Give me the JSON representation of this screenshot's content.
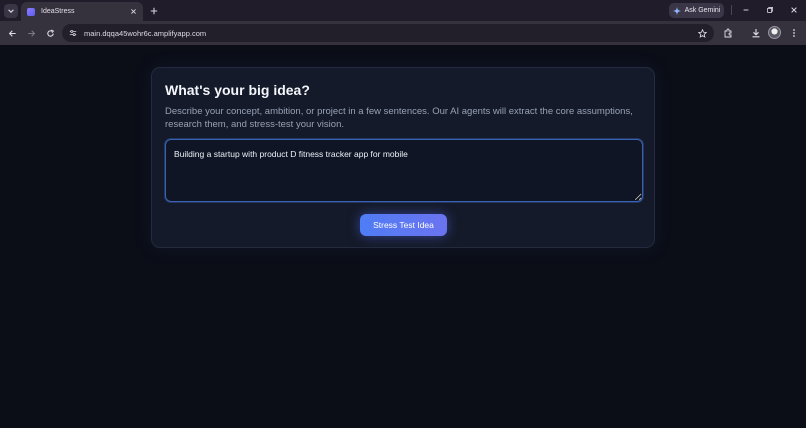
{
  "browser": {
    "tab": {
      "title": "IdeaStress"
    },
    "gemini_label": "Ask Gemini",
    "url": "main.dqqa45wohr6c.amplifyapp.com"
  },
  "page": {
    "heading": "What's your big idea?",
    "description": "Describe your concept, ambition, or project in a few sentences. Our AI agents will extract the core assumptions, research them, and stress-test your vision.",
    "idea_value": "Building a startup with product D fitness tracker app for mobile",
    "submit_label": "Stress Test Idea"
  },
  "colors": {
    "background": "#0b0e17",
    "card": "#141a29",
    "accent": "#5b78f3"
  }
}
